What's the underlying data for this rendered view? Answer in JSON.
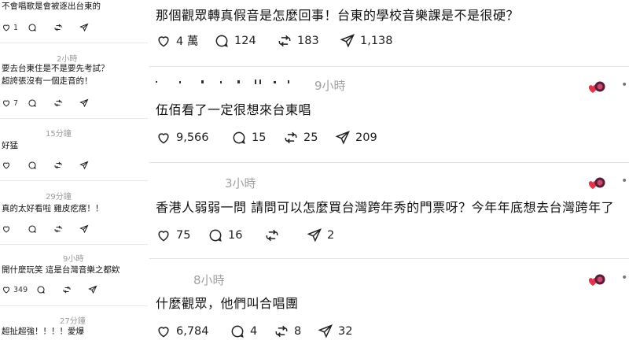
{
  "left": {
    "posts": [
      {
        "time": "",
        "text": [
          "不會唱歌是會被逐出台東的"
        ],
        "likes": "1"
      },
      {
        "time": "2小時",
        "text": [
          "要去台東住是不是要先考試？",
          "超誇張沒有一個走音的！"
        ],
        "likes": "7"
      },
      {
        "time": "15分鐘",
        "text": [
          "好猛"
        ],
        "likes": ""
      },
      {
        "time": "29分鐘",
        "text": [
          "真的太好看啦 雞皮疙瘩！！"
        ],
        "likes": ""
      },
      {
        "time": "9小時",
        "text": [
          "開什麼玩笑 這是台灣音樂之都欸"
        ],
        "likes": "349"
      },
      {
        "time": "27分鐘",
        "text": [
          "超扯超強！！！！愛爆"
        ],
        "likes": ""
      }
    ]
  },
  "right": {
    "posts": [
      {
        "time": "",
        "text": "那個觀眾轉真假音是怎麼回事！台東的學校音樂課是不是很硬？",
        "likes": "4 萬",
        "comments": "124",
        "reposts": "183",
        "shares": "1,138"
      },
      {
        "time": "9小時",
        "text": "伍佰看了一定很想來台東唱",
        "likes": "9,566",
        "comments": "15",
        "reposts": "25",
        "shares": "209"
      },
      {
        "time": "3小時",
        "text": "香港人弱弱一問 請問可以怎麼買台灣跨年秀的門票呀？今年年底想去台灣跨年了",
        "likes": "75",
        "comments": "16",
        "reposts": "",
        "shares": "2"
      },
      {
        "time": "8小時",
        "text": "什麼觀眾，他們叫合唱團",
        "likes": "6,784",
        "comments": "4",
        "reposts": "8",
        "shares": "32"
      }
    ]
  },
  "icons": [
    "heart-icon",
    "comment-icon",
    "repost-icon",
    "share-icon",
    "more-icon"
  ],
  "colors": {
    "avatar_red": "#e0344a",
    "avatar_dark": "#5a1a3a",
    "muted": "#9a9a9a"
  }
}
